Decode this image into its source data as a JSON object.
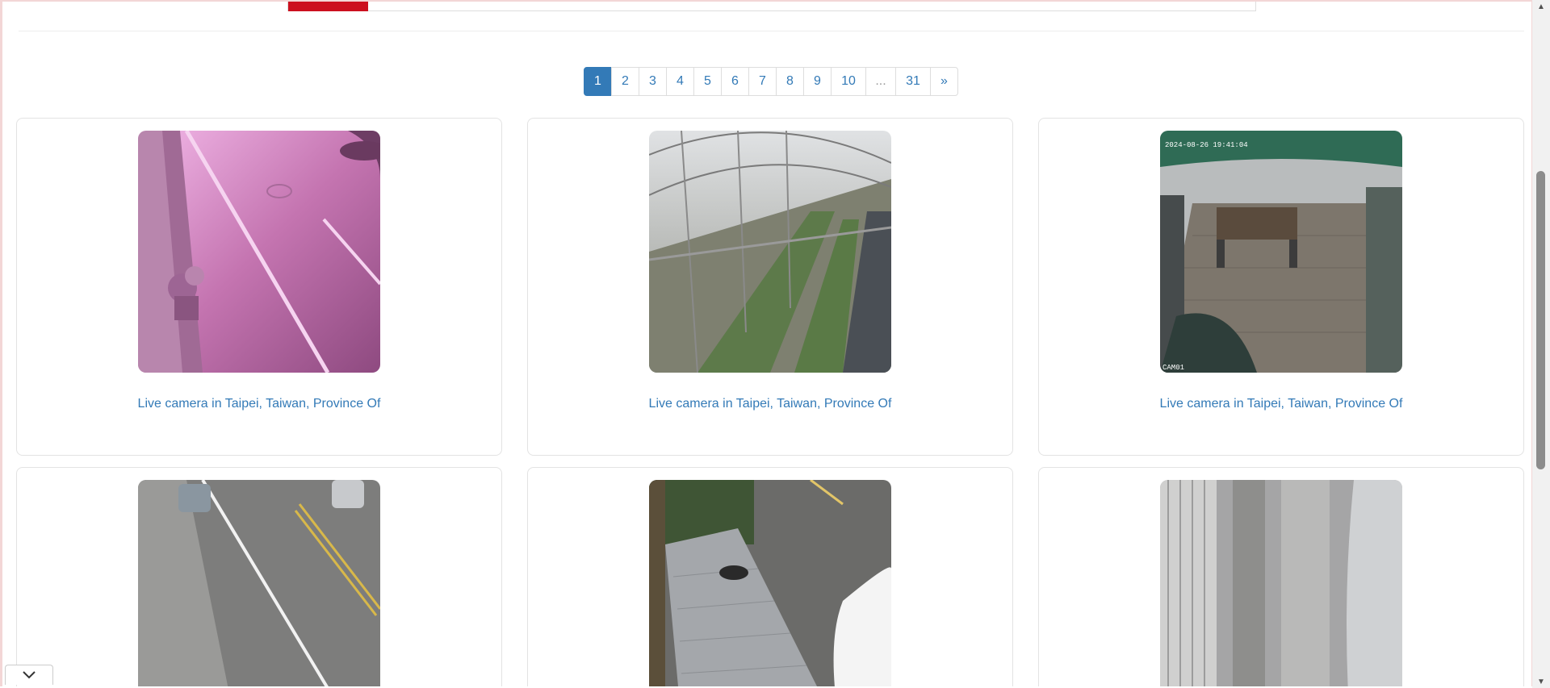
{
  "pagination": {
    "pages": [
      "1",
      "2",
      "3",
      "4",
      "5",
      "6",
      "7",
      "8",
      "9",
      "10",
      "...",
      "31",
      "»"
    ],
    "active": "1"
  },
  "cameras": [
    {
      "caption": "Live camera in Taipei, Taiwan, Province Of",
      "scene": "pink street curb view"
    },
    {
      "caption": "Live camera in Taipei, Taiwan, Province Of",
      "scene": "greenhouse interior"
    },
    {
      "caption": "Live camera in Taipei, Taiwan, Province Of",
      "scene": "rooftop deck with table",
      "overlay_text": "2024-08-26 19:41:04",
      "corner_text": "CAM01"
    },
    {
      "caption": "",
      "scene": "street with parked cars"
    },
    {
      "caption": "",
      "scene": "sidewalk with white car"
    },
    {
      "caption": "",
      "scene": "paved alley with car"
    }
  ],
  "colors": {
    "accent": "#337ab7",
    "brand_red": "#cc0f1e"
  },
  "icons": {
    "collapse": "chevron-down-icon",
    "scroll_up": "triangle-up-icon",
    "scroll_down": "triangle-down-icon"
  }
}
